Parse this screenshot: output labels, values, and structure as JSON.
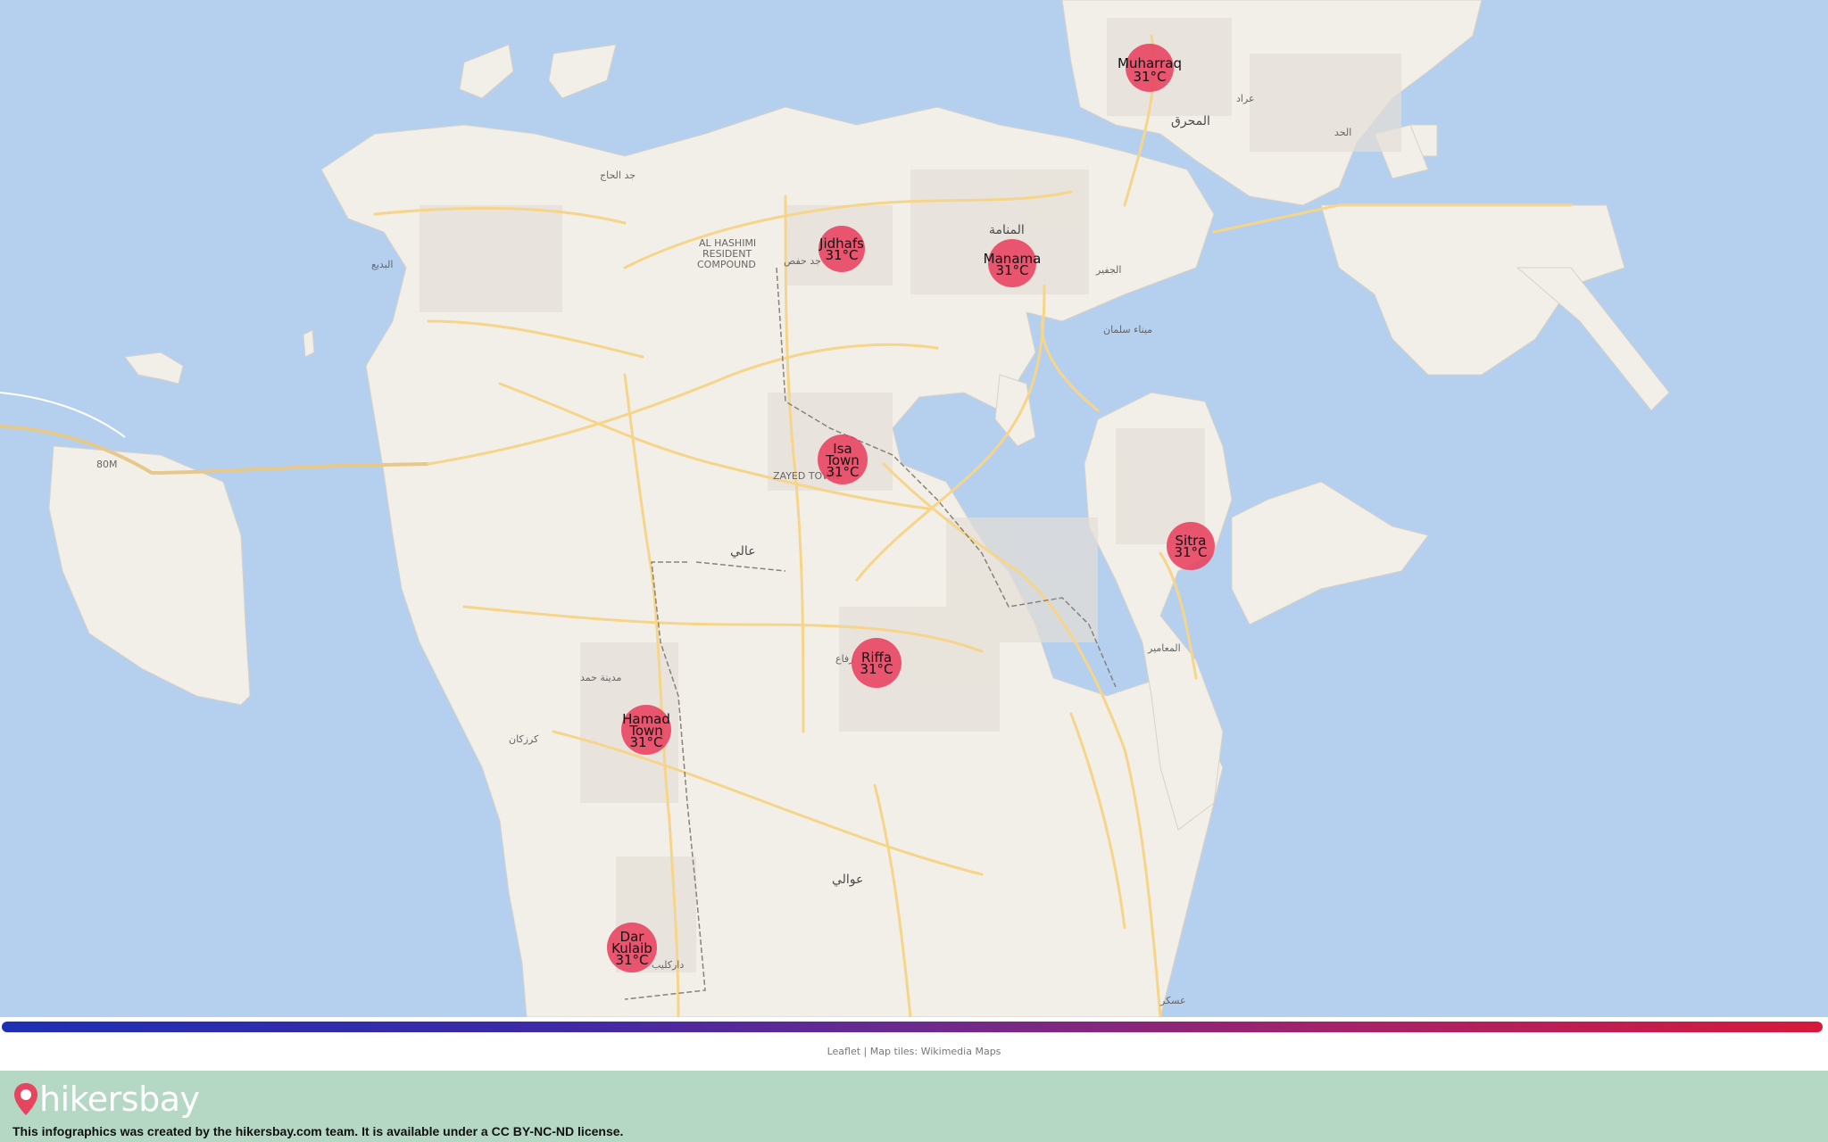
{
  "map": {
    "cities": [
      {
        "name": "Muharraq",
        "lines": [
          "Muharraq",
          "31°C"
        ]
      },
      {
        "name": "Jidhafs",
        "lines": [
          "Jidhafs",
          "31°C"
        ]
      },
      {
        "name": "Manama",
        "lines": [
          "Manama",
          "31°C"
        ]
      },
      {
        "name": "Isa Town",
        "lines": [
          "Isa",
          "Town",
          "31°C"
        ]
      },
      {
        "name": "Sitra",
        "lines": [
          "Sitra",
          "31°C"
        ]
      },
      {
        "name": "Riffa",
        "lines": [
          "Riffa",
          "31°C"
        ]
      },
      {
        "name": "Hamad Town",
        "lines": [
          "Hamad",
          "Town",
          "31°C"
        ]
      },
      {
        "name": "Dar Kulaib",
        "lines": [
          "Dar",
          "Kulaib",
          "31°C"
        ]
      }
    ],
    "place_labels": {
      "muharraq_ar": "المحرق",
      "manama_ar": "المنامة",
      "jidhafs_ar": "جد حفص",
      "budaiya_ar": "البديع",
      "hamad_ar": "مدينة حمد",
      "aali_ar": "عالي",
      "awali_ar": "عوالي",
      "maameer_ar": "المعامير",
      "karzakan_ar": "كرزكان",
      "darkulaib_ar": "داركليب",
      "askar_ar": "عسكر",
      "mina_ar": "ميناء سلمان",
      "hidd_ar": "الحد",
      "arad_ar": "عراد",
      "juffair_ar": "الجفير",
      "janabiya_ar": "جد الحاج",
      "riffa_ar": "رفاع",
      "hashimi": [
        "AL HASHIMI",
        "RESIDENT",
        "COMPOUND"
      ],
      "zayed": "ZAYED TOWN",
      "road_80m": "80M"
    }
  },
  "attribution": {
    "leaflet": "Leaflet",
    "rest": " | Map tiles: Wikimedia Maps"
  },
  "footer": {
    "logo": "hikersbay",
    "license": "This infographics was created by the hikersbay.com team. It is available under a CC BY-NC-ND license."
  },
  "colors": {
    "water": "#b5d0ef",
    "land": "#f2efe9",
    "marker": "#e8415f",
    "footer": "#b4d8c3"
  }
}
